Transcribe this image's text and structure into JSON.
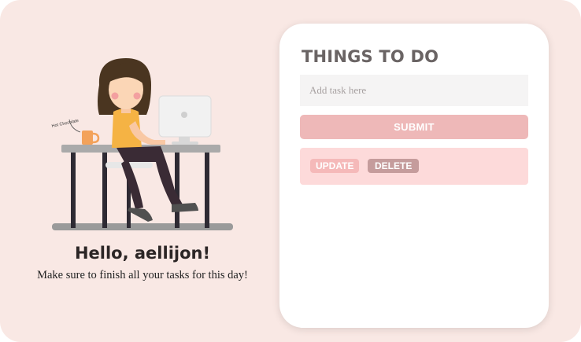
{
  "greeting": {
    "title": "Hello, aellijon!",
    "subtitle": "Make sure to finish all your tasks for this day!"
  },
  "illustration": {
    "mug_label": "Hot Chocolate"
  },
  "todo": {
    "title": "THINGS TO DO",
    "input_placeholder": "Add task here",
    "submit_label": "SUBMIT",
    "items": [
      {
        "text": "",
        "update_label": "UPDATE",
        "delete_label": "DELETE"
      }
    ]
  },
  "colors": {
    "page_bg": "#f9e8e4",
    "card_bg": "#ffffff",
    "submit_bg": "#eeb8b8",
    "task_bg": "#fddada",
    "update_bg": "#f5b9b9",
    "delete_bg": "#c59c9c",
    "title_color": "#6a6464"
  }
}
